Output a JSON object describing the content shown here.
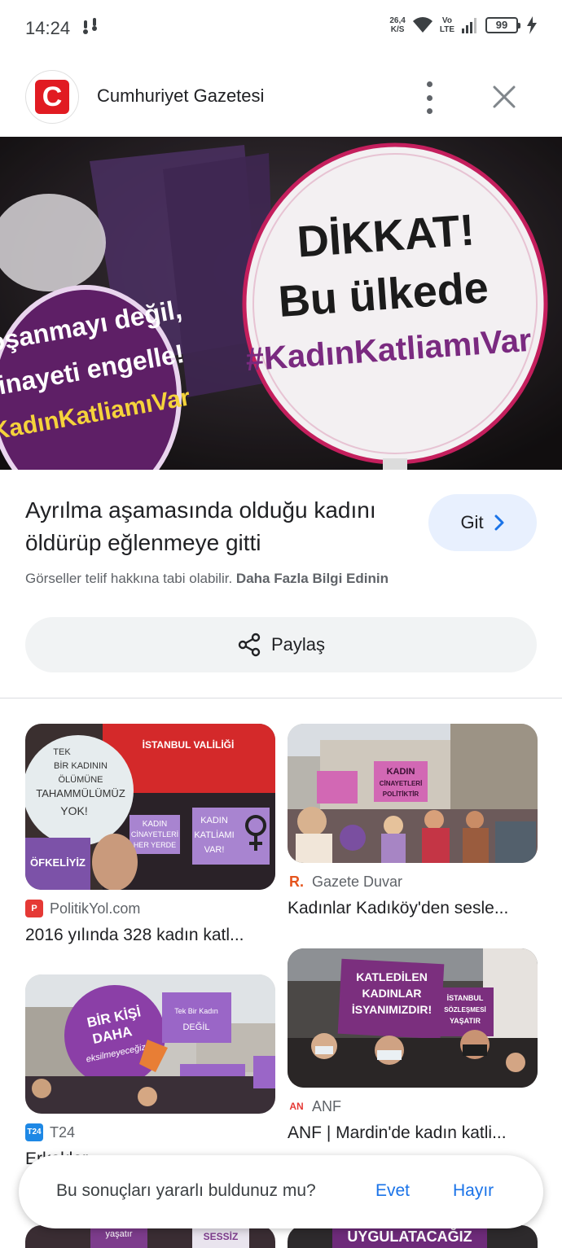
{
  "status_bar": {
    "time": "14:24",
    "net_speed": "26,4",
    "net_unit": "K/S",
    "volte_top": "Vo",
    "volte_bottom": "LTE",
    "battery": "99"
  },
  "header": {
    "source_name": "Cumhuriyet Gazetesi",
    "logo_letter": "C"
  },
  "hero": {
    "sign_right_lines": [
      "DİKKAT!",
      "Bu ülkede",
      "#KadınKatliamıVar"
    ],
    "sign_left_lines": [
      "Boşanmayı değil,",
      "cinayeti engelle!",
      "#KadınKatliamıVar"
    ]
  },
  "article": {
    "title": "Ayrılma aşamasında olduğu kadını öldürüp eğlenmeye gitti",
    "go_label": "Git",
    "copyright_text": "Görseller telif hakkına tabi olabilir.",
    "learn_more": "Daha Fazla Bilgi Edinin",
    "share_label": "Paylaş"
  },
  "related": [
    {
      "source": "PolitikYol.com",
      "title": "2016 yılında 328 kadın katl...",
      "sign_text": [
        "TEK",
        "BİR KADININ",
        "ÖLÜMÜNE",
        "TAHAMMÜLÜMÜZ",
        "YOK!"
      ],
      "banner_text": "İSTANBUL VALİLİĞİ",
      "card_text": [
        "KADIN",
        "CİNAYETLERİ",
        "HER YERDE"
      ],
      "card2_text": [
        "KADIN",
        "KATLİAMI",
        "VAR!"
      ],
      "left_text": "ÖFKELİYİZ"
    },
    {
      "source": "Gazete Duvar",
      "title": "Kadınlar Kadıköy'den sesle...",
      "sign_text": [
        "KADIN",
        "CİNAYETLERİ",
        "POLİTİKTİR"
      ]
    },
    {
      "source": "T24",
      "title": "Erkekler...",
      "sign_text": [
        "BİR KİŞİ",
        "DAHA",
        "eksilmeyeceğiz"
      ],
      "card_text": [
        "Tek Bir Kadın",
        "DEĞİL"
      ]
    },
    {
      "source": "ANF",
      "title": "ANF | Mardin'de kadın katli...",
      "sign_text": [
        "KATLEDİLEN",
        "KADINLAR",
        "İSYANIMIZDIR!"
      ],
      "side_text": [
        "İSTANBUL",
        "SÖZLEŞMESİ",
        "YAŞATIR"
      ]
    }
  ],
  "bottom_peek": {
    "left_text": [
      "yaşatır",
      "SESSİZ"
    ],
    "right_text": "UYGULATACAĞIZ"
  },
  "feedback": {
    "question": "Bu sonuçları yararlı buldunuz mu?",
    "yes": "Evet",
    "no": "Hayır"
  },
  "colors": {
    "accent": "#1a73e8",
    "logo_red": "#e11b22",
    "protest_purple": "#6a2a8a"
  }
}
